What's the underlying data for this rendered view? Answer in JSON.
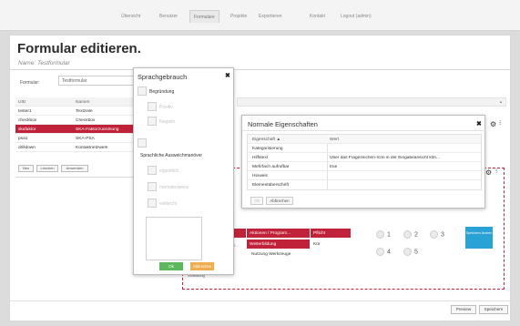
{
  "nav": {
    "items": [
      "Übersicht",
      "Benutzer",
      "Formulare",
      "Projekte",
      "Exportieren",
      "Kontakt",
      "Logout (admin)"
    ],
    "active": "Formulare"
  },
  "page": {
    "title": "Formular editieren.",
    "subtitle": "Name: Testformular"
  },
  "form": {
    "label": "Formular:",
    "value": "Testformular"
  },
  "left_table": {
    "headers": [
      "UID",
      "Namen"
    ],
    "rows": [
      {
        "uid": "tester1",
        "name": "Textzeile"
      },
      {
        "uid": "checkbox",
        "name": "Checkbox"
      },
      {
        "uid": "skafaktor",
        "name": "SKA-Faktorzuordnung"
      },
      {
        "uid": "psa1",
        "name": "SKA-PSA"
      },
      {
        "uid": "drilldown",
        "name": "Kontaktnetzwerk"
      }
    ],
    "selected_index": 2,
    "buttons": [
      "Neu",
      "Löschen",
      "Anwenden"
    ]
  },
  "designer": {
    "header_cells": [
      "Aktionen / Program...",
      "Pflicht"
    ],
    "row_cells": [
      "Weiterbildung",
      "Kür",
      "Nutzung Werkzeuge"
    ],
    "partial_left": "Z...",
    "left_bottom_label": "Vorbildung",
    "radio_labels": [
      "1",
      "2",
      "3",
      "4",
      "5"
    ],
    "blue_button": "Speichern Ändern"
  },
  "bottom_buttons": [
    "Preview",
    "Speichern"
  ],
  "sprachgebrauch": {
    "title": "Sprachgebrauch",
    "close": "✖",
    "items": [
      {
        "label": "Begründung",
        "disabled": false
      },
      {
        "label": "Positiv",
        "disabled": true
      },
      {
        "label": "Negativ",
        "disabled": true
      },
      {
        "label": "Sprachliche Ausweichmanöver",
        "disabled": false
      },
      {
        "label": "eigentlich",
        "disabled": true
      },
      {
        "label": "normalerweise",
        "disabled": true
      },
      {
        "label": "vielleicht",
        "disabled": true
      }
    ],
    "ok": "Ok",
    "cancel": "Abbrechen"
  },
  "eigenschaften": {
    "title": "Normale Eigenschaften",
    "close": "✖",
    "headers": [
      "Eigenschaft ▲",
      "Wert"
    ],
    "rows": [
      {
        "prop": "Kategorisierung",
        "val": ""
      },
      {
        "prop": "Hilfstext",
        "val": "Über das Fragezeichen-Icon in der Eingabeansicht kön..."
      },
      {
        "prop": "Mehrfach aufrufbar",
        "val": "true"
      },
      {
        "prop": "Hinweis",
        "val": ""
      },
      {
        "prop": "Elementüberschrift",
        "val": ""
      }
    ],
    "buttons": [
      "Ok",
      "Abbrechen"
    ]
  }
}
